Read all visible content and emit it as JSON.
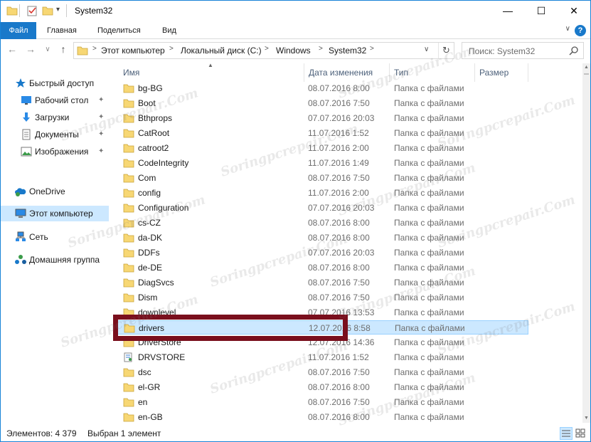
{
  "window": {
    "title": "System32",
    "controls": {
      "minimize": "—",
      "maximize": "☐",
      "close": "✕"
    }
  },
  "ribbon": {
    "tabs": [
      "Файл",
      "Главная",
      "Поделиться",
      "Вид"
    ],
    "help": "?",
    "expand": "∨"
  },
  "address": {
    "breadcrumbs": [
      "Этот компьютер",
      "Локальный диск (C:)",
      "Windows",
      "System32"
    ],
    "separator": ">",
    "search_placeholder": "Поиск: System32"
  },
  "navpane": {
    "items": [
      {
        "label": "Быстрый доступ",
        "icon": "star-icon",
        "pinned": false
      },
      {
        "label": "Рабочий стол",
        "icon": "desktop-icon",
        "pinned": true
      },
      {
        "label": "Загрузки",
        "icon": "download-icon",
        "pinned": true
      },
      {
        "label": "Документы",
        "icon": "documents-icon",
        "pinned": true
      },
      {
        "label": "Изображения",
        "icon": "pictures-icon",
        "pinned": true
      },
      {
        "label": "OneDrive",
        "icon": "onedrive-icon",
        "pinned": false
      },
      {
        "label": "Этот компьютер",
        "icon": "computer-icon",
        "pinned": false,
        "selected": true
      },
      {
        "label": "Сеть",
        "icon": "network-icon",
        "pinned": false
      },
      {
        "label": "Домашняя группа",
        "icon": "homegroup-icon",
        "pinned": false
      }
    ],
    "pin_glyph": "✦"
  },
  "columns": [
    "Имя",
    "Дата изменения",
    "Тип",
    "Размер"
  ],
  "files": [
    {
      "name": "bg-BG",
      "date": "08.07.2016 8:00",
      "type": "Папка с файлами"
    },
    {
      "name": "Boot",
      "date": "08.07.2016 7:50",
      "type": "Папка с файлами"
    },
    {
      "name": "Bthprops",
      "date": "07.07.2016 20:03",
      "type": "Папка с файлами"
    },
    {
      "name": "CatRoot",
      "date": "11.07.2016 1:52",
      "type": "Папка с файлами"
    },
    {
      "name": "catroot2",
      "date": "11.07.2016 2:00",
      "type": "Папка с файлами"
    },
    {
      "name": "CodeIntegrity",
      "date": "11.07.2016 1:49",
      "type": "Папка с файлами"
    },
    {
      "name": "Com",
      "date": "08.07.2016 7:50",
      "type": "Папка с файлами"
    },
    {
      "name": "config",
      "date": "11.07.2016 2:00",
      "type": "Папка с файлами"
    },
    {
      "name": "Configuration",
      "date": "07.07.2016 20:03",
      "type": "Папка с файлами"
    },
    {
      "name": "cs-CZ",
      "date": "08.07.2016 8:00",
      "type": "Папка с файлами"
    },
    {
      "name": "da-DK",
      "date": "08.07.2016 8:00",
      "type": "Папка с файлами"
    },
    {
      "name": "DDFs",
      "date": "07.07.2016 20:03",
      "type": "Папка с файлами"
    },
    {
      "name": "de-DE",
      "date": "08.07.2016 8:00",
      "type": "Папка с файлами"
    },
    {
      "name": "DiagSvcs",
      "date": "08.07.2016 7:50",
      "type": "Папка с файлами"
    },
    {
      "name": "Dism",
      "date": "08.07.2016 7:50",
      "type": "Папка с файлами"
    },
    {
      "name": "downlevel",
      "date": "07.07.2016 13:53",
      "type": "Папка с файлами"
    },
    {
      "name": "drivers",
      "date": "12.07.2016 8:58",
      "type": "Папка с файлами",
      "selected": true
    },
    {
      "name": "DriverStore",
      "date": "12.07.2016 14:36",
      "type": "Папка с файлами"
    },
    {
      "name": "DRVSTORE",
      "date": "11.07.2016 1:52",
      "type": "Папка с файлами",
      "special": true
    },
    {
      "name": "dsc",
      "date": "08.07.2016 7:50",
      "type": "Папка с файлами"
    },
    {
      "name": "el-GR",
      "date": "08.07.2016 8:00",
      "type": "Папка с файлами"
    },
    {
      "name": "en",
      "date": "08.07.2016 7:50",
      "type": "Папка с файлами"
    },
    {
      "name": "en-GB",
      "date": "08.07.2016 8:00",
      "type": "Папка с файлами"
    }
  ],
  "status": {
    "count": "Элементов: 4 379",
    "selection": "Выбран 1 элемент"
  },
  "watermark": "Soringpcrepair.Com",
  "colors": {
    "accent": "#1979ca",
    "selection": "#cce8ff",
    "highlight_frame": "#7a0f1d",
    "folder": "#f7d774"
  }
}
